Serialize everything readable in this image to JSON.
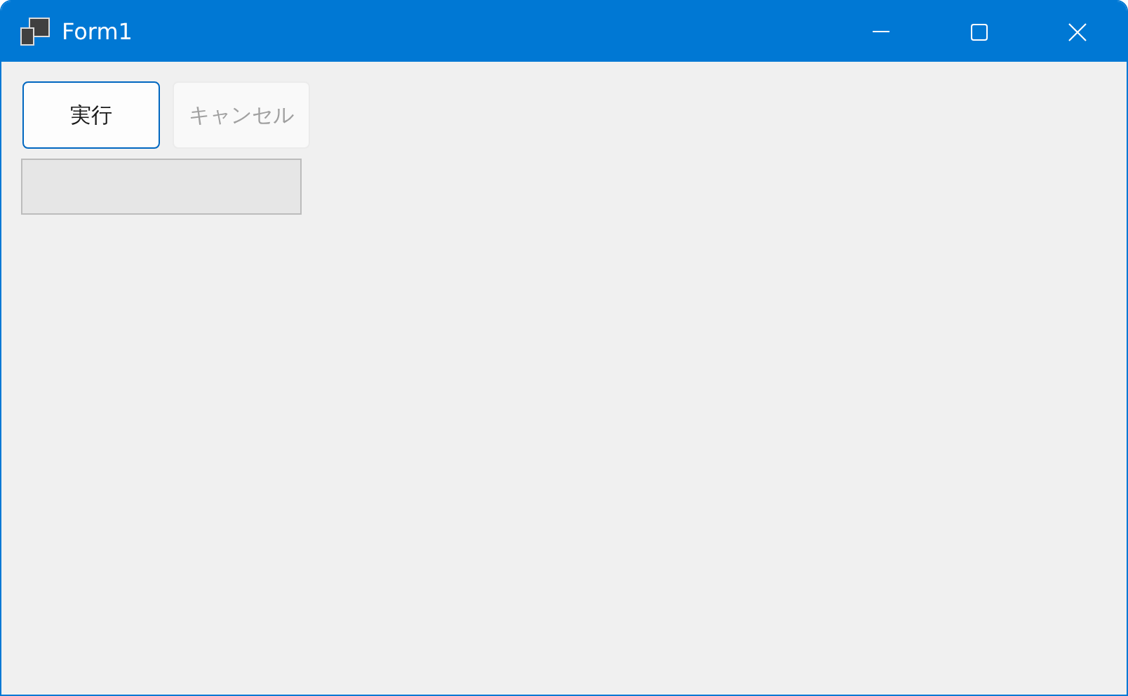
{
  "window": {
    "title": "Form1"
  },
  "buttons": [
    {
      "label": "実行",
      "disabled": false,
      "focused": true
    },
    {
      "label": "キャンセル",
      "disabled": true,
      "focused": false
    }
  ],
  "progress_bar": {
    "level": 0
  }
}
